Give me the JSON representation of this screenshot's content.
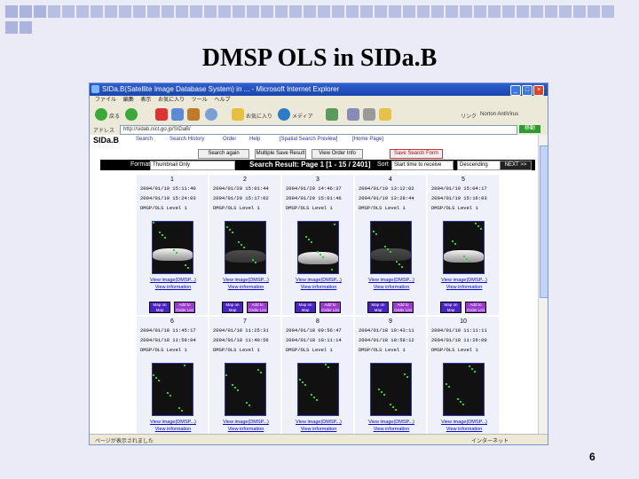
{
  "slide": {
    "title": "DMSP OLS in SIDa.B",
    "page_number": "6"
  },
  "browser": {
    "window_title": "SIDa.B(Satellite Image Database System) in ... - Microsoft Internet Explorer",
    "menu": [
      "ファイル",
      "編集",
      "表示",
      "お気に入り",
      "ツール",
      "ヘルプ"
    ],
    "toolbar": {
      "back_label": "戻る",
      "favorites_label": "お気に入り",
      "media_label": "メディア",
      "links_label": "リンク",
      "right_label": "Norton AntiVirus"
    },
    "address_label": "アドレス",
    "address_value": "http://sidab.nict.go.jp/SIDaB/",
    "go_label": "移動",
    "status_text": "ページが表示されました",
    "status_zone": "インターネット"
  },
  "sidab": {
    "logo": "SIDa.B",
    "nav": [
      "Search",
      "Search History",
      "Order",
      "Help",
      "[Spatial Search Preview]",
      "[Home Page]"
    ],
    "buttons": [
      "Search again",
      "Multiple Save Result",
      "View Order Info",
      "Save Search Form"
    ],
    "format_label": "Format",
    "format_value": "Thumbnail Only",
    "result_title": "Search Result: Page 1 [1 - 15 / 2401]",
    "sort_label": "Sort",
    "sort_value": "Start time to receive",
    "order_value": "Descending",
    "next_label": "NEXT >>"
  },
  "results": [
    {
      "num": "1",
      "start": "2004/01/19 15:11:40",
      "end": "2004/01/19 15:24:03",
      "sensor": "DMSP/OLS  Level 1",
      "link1": "View image(DMSP...)",
      "link2": "View information"
    },
    {
      "num": "2",
      "start": "2004/01/20 15:01:44",
      "end": "2004/01/20 15:17:02",
      "sensor": "DMSP/OLS  Level 1",
      "link1": "View image(DMSP...)",
      "link2": "View information"
    },
    {
      "num": "3",
      "start": "2004/01/20 14:46:37",
      "end": "2004/01/20 15:01:46",
      "sensor": "DMSP/OLS  Level 1",
      "link1": "View image(DMSP...)",
      "link2": "View information"
    },
    {
      "num": "4",
      "start": "2004/01/19 13:12:02",
      "end": "2004/01/19 13:28:44",
      "sensor": "DMSP/OLS  Level 1",
      "link1": "View image(DMSP...)",
      "link2": "View information"
    },
    {
      "num": "5",
      "start": "2004/01/19 15:04:17",
      "end": "2004/01/19 15:16:03",
      "sensor": "DMSP/OLS  Level 1",
      "link1": "View image(DMSP...)",
      "link2": "View information"
    },
    {
      "num": "6",
      "start": "2004/01/18 11:45:17",
      "end": "2004/01/18 11:59:04",
      "sensor": "DMSP/OLS  Level 1",
      "link1": "View image(DMSP...)",
      "link2": "View information"
    },
    {
      "num": "7",
      "start": "2004/01/18 11:25:31",
      "end": "2004/01/18 11:40:56",
      "sensor": "DMSP/OLS  Level 1",
      "link1": "View image(DMSP...)",
      "link2": "View information"
    },
    {
      "num": "8",
      "start": "2004/01/18 09:56:47",
      "end": "2004/01/18 10:11:14",
      "sensor": "DMSP/OLS  Level 1",
      "link1": "View image(DMSP...)",
      "link2": "View information"
    },
    {
      "num": "9",
      "start": "2004/01/18 10:43:11",
      "end": "2004/01/18 10:58:12",
      "sensor": "DMSP/OLS  Level 1",
      "link1": "View image(DMSP...)",
      "link2": "View information"
    },
    {
      "num": "10",
      "start": "2004/01/18 11:11:11",
      "end": "2004/01/18 11:26:09",
      "sensor": "DMSP/OLS  Level 1",
      "link1": "View image(DMSP...)",
      "link2": "View information"
    }
  ],
  "cell_buttons": {
    "map_label": "Map on Map",
    "add_label": "Add to Order List"
  },
  "colors": {
    "slide_bg": "#ebebf7",
    "deco_square": "#aab4dc",
    "titlebar": "#2c5fcf",
    "cell_bg": "#eef0fa",
    "map_btn": "#4b22c6",
    "add_btn": "#9b3ad0"
  }
}
